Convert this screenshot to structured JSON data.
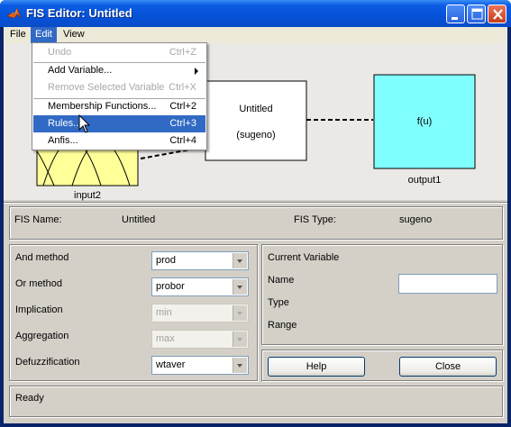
{
  "window": {
    "title": "FIS Editor: Untitled"
  },
  "menubar": {
    "file": "File",
    "edit": "Edit",
    "view": "View"
  },
  "edit_menu": {
    "undo": {
      "label": "Undo",
      "shortcut": "Ctrl+Z"
    },
    "add_variable": {
      "label": "Add Variable..."
    },
    "remove_variable": {
      "label": "Remove Selected Variable",
      "shortcut": "Ctrl+X"
    },
    "membership_functions": {
      "label": "Membership Functions...",
      "shortcut": "Ctrl+2"
    },
    "rules": {
      "label": "Rules...",
      "shortcut": "Ctrl+3"
    },
    "anfis": {
      "label": "Anfis...",
      "shortcut": "Ctrl+4"
    }
  },
  "diagram": {
    "system_name": "Untitled",
    "system_type": "(sugeno)",
    "input_label": "input2",
    "output_label": "output1",
    "output_function": "f(u)",
    "colors": {
      "input": "#ffff99",
      "output": "#80ffff",
      "system": "#ffffff"
    }
  },
  "info": {
    "fis_name_label": "FIS Name:",
    "fis_name_value": "Untitled",
    "fis_type_label": "FIS Type:",
    "fis_type_value": "sugeno"
  },
  "methods": {
    "and_label": "And method",
    "and_value": "prod",
    "or_label": "Or method",
    "or_value": "probor",
    "implication_label": "Implication",
    "implication_value": "min",
    "aggregation_label": "Aggregation",
    "aggregation_value": "max",
    "defuzz_label": "Defuzzification",
    "defuzz_value": "wtaver"
  },
  "current_variable": {
    "title": "Current Variable",
    "name_label": "Name",
    "name_value": "",
    "type_label": "Type",
    "range_label": "Range"
  },
  "buttons": {
    "help": "Help",
    "close": "Close"
  },
  "status": {
    "text": "Ready"
  }
}
